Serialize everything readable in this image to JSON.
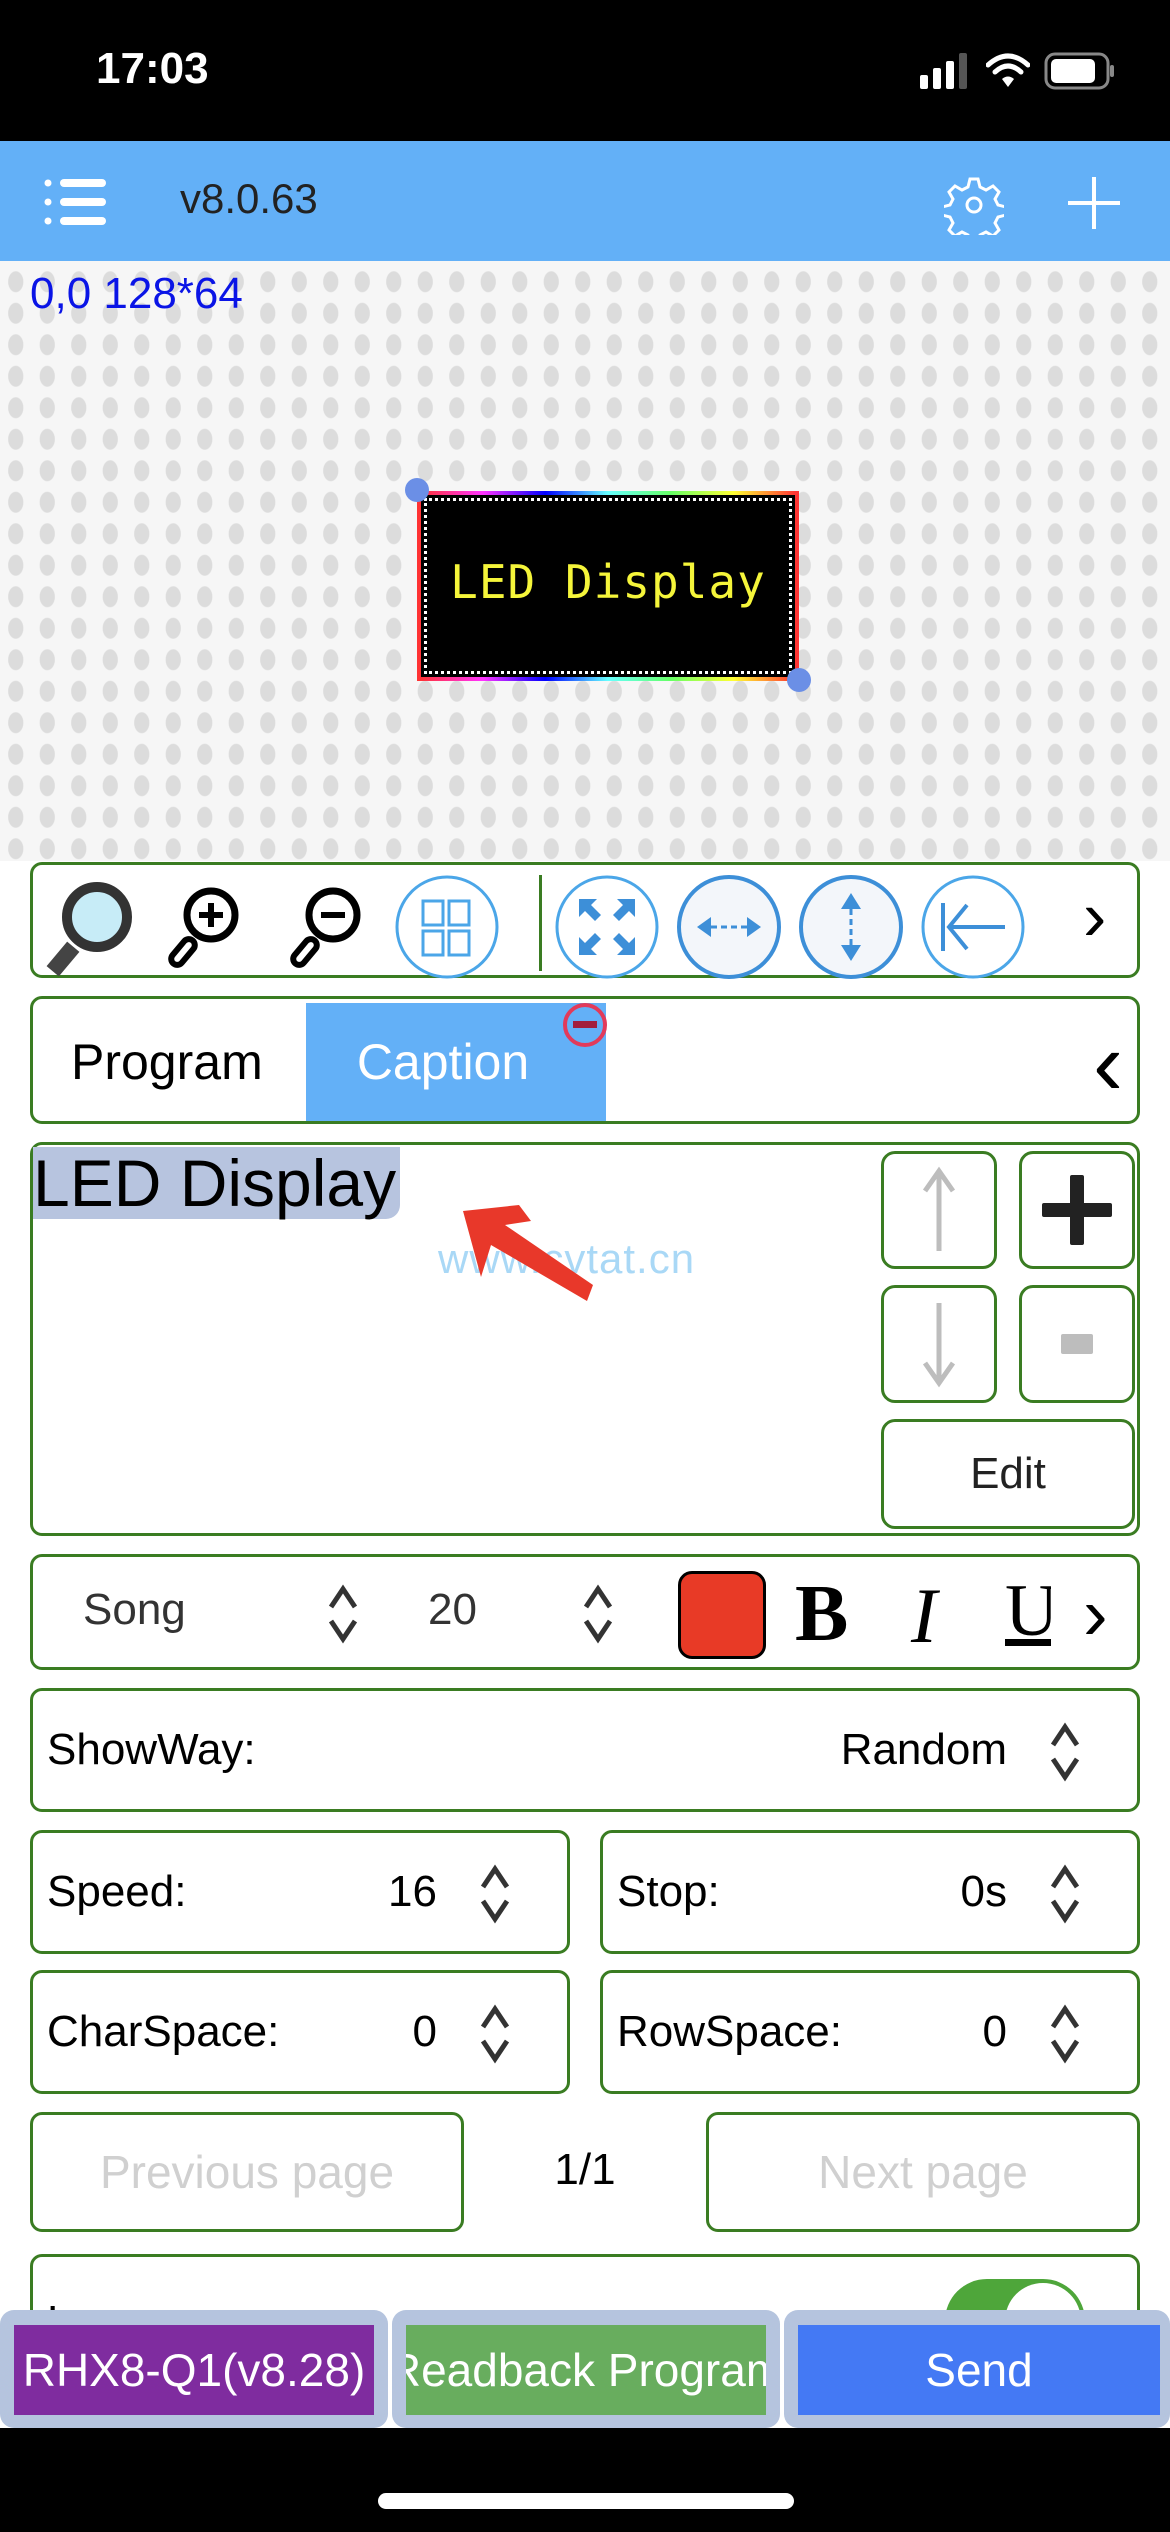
{
  "status_bar": {
    "time": "17:03",
    "icons": [
      "cellular-signal-icon",
      "wifi-icon",
      "battery-icon"
    ]
  },
  "header": {
    "version": "v8.0.63",
    "icons": {
      "menu": "menu-icon",
      "settings": "gear-icon",
      "add": "plus-icon"
    }
  },
  "canvas": {
    "coords_label": "0,0 128*64",
    "led_preview_text": "LED Display",
    "led_text_color": "#f5f53a"
  },
  "toolbar": {
    "tools": [
      {
        "name": "search-icon"
      },
      {
        "name": "zoom-in-icon"
      },
      {
        "name": "zoom-out-icon"
      },
      {
        "name": "grid-icon"
      },
      {
        "name": "fullscreen-expand-icon"
      },
      {
        "name": "center-horizontal-icon"
      },
      {
        "name": "center-vertical-icon"
      },
      {
        "name": "align-left-icon"
      }
    ],
    "more_label": "›"
  },
  "tabs": {
    "items": [
      {
        "label": "Program",
        "active": false
      },
      {
        "label": "Caption",
        "active": true
      }
    ],
    "back_label": "‹"
  },
  "caption_list": {
    "items": [
      {
        "text": "LED Display",
        "selected": true
      }
    ],
    "watermark": "www.cvtat.cn",
    "edit_label": "Edit"
  },
  "format": {
    "font_name": "Song",
    "font_size": "20",
    "color": "#e83a26",
    "bold_label": "B",
    "italic_label": "I",
    "underline_label": "U",
    "more_label": "›"
  },
  "settings": {
    "showway": {
      "label": "ShowWay:",
      "value": "Random"
    },
    "speed": {
      "label": "Speed:",
      "value": "16"
    },
    "stop": {
      "label": "Stop:",
      "value": "0s"
    },
    "charspace": {
      "label": "CharSpace:",
      "value": "0"
    },
    "rowspace": {
      "label": "RowSpace:",
      "value": "0"
    }
  },
  "pager": {
    "prev_label": "Previous page",
    "next_label": "Next page",
    "page": "1/1"
  },
  "loop": {
    "label": "Loop:",
    "enabled": true
  },
  "bottom_bar": {
    "device_label": "RHX8-Q1(v8.28)",
    "readback_label": "Readback Program",
    "send_label": "Send",
    "colors": {
      "device": "#7f2c9f",
      "readback": "#68ad5e",
      "send": "#4479f4"
    }
  }
}
